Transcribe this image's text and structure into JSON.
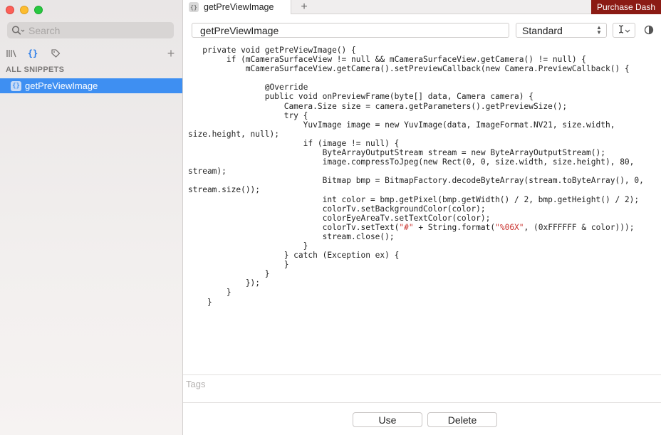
{
  "sidebar": {
    "search_placeholder": "Search",
    "section_title": "ALL SNIPPETS",
    "icons": [
      "library-icon",
      "snippets-icon",
      "tag-icon",
      "add-icon"
    ],
    "items": [
      {
        "label": "getPreViewImage",
        "selected": true
      }
    ]
  },
  "tabs": {
    "items": [
      {
        "label": "getPreViewImage"
      }
    ],
    "add_label": "+",
    "purchase_label": "Purchase Dash"
  },
  "editor": {
    "title_value": "getPreViewImage",
    "syntax_value": "Standard",
    "code_lines": [
      "   private void getPreViewImage() {",
      "        if (mCameraSurfaceView != null && mCameraSurfaceView.getCamera() != null) {",
      "            mCameraSurfaceView.getCamera().setPreviewCallback(new Camera.PreviewCallback() {",
      "",
      "                @Override",
      "                public void onPreviewFrame(byte[] data, Camera camera) {",
      "                    Camera.Size size = camera.getParameters().getPreviewSize();",
      "                    try {",
      "                        YuvImage image = new YuvImage(data, ImageFormat.NV21, size.width,",
      "size.height, null);",
      "                        if (image != null) {",
      "                            ByteArrayOutputStream stream = new ByteArrayOutputStream();",
      "                            image.compressToJpeg(new Rect(0, 0, size.width, size.height), 80,",
      "stream);",
      "                            Bitmap bmp = BitmapFactory.decodeByteArray(stream.toByteArray(), 0,",
      "stream.size());",
      "                            int color = bmp.getPixel(bmp.getWidth() / 2, bmp.getHeight() / 2);",
      "                            colorTv.setBackgroundColor(color);",
      "                            colorEyeAreaTv.setTextColor(color);",
      "                            colorTv.setText(\"#\" + String.format(\"%06X\", (0xFFFFFF & color)));",
      "                            stream.close();",
      "                        }",
      "                    } catch (Exception ex) {",
      "                    }",
      "                }",
      "            });",
      "        }",
      "    }"
    ]
  },
  "tags": {
    "placeholder": "Tags"
  },
  "actions": {
    "use_label": "Use",
    "delete_label": "Delete"
  },
  "colors": {
    "accent": "#3e8ff2",
    "purchase_bg": "#8b1b14",
    "string_literal": "#c9302c"
  }
}
